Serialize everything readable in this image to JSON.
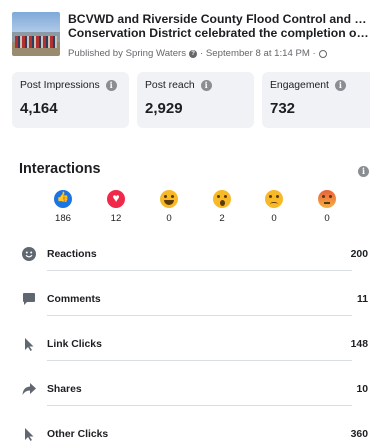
{
  "post": {
    "title_line1": "BCVWD and Riverside County Flood Control and Water",
    "title_line2": "Conservation District celebrated the completion of our...",
    "published_by": "Published by Spring Waters",
    "date": "· September 8 at 1:14 PM ·"
  },
  "metrics": [
    {
      "label": "Post Impressions",
      "value": "4,164"
    },
    {
      "label": "Post reach",
      "value": "2,929"
    },
    {
      "label": "Engagement",
      "value": "732"
    }
  ],
  "interactions": {
    "title": "Interactions",
    "reactions": [
      {
        "icon": "like-icon",
        "count": "186"
      },
      {
        "icon": "love-icon",
        "count": "12"
      },
      {
        "icon": "haha-icon",
        "count": "0"
      },
      {
        "icon": "wow-icon",
        "count": "2"
      },
      {
        "icon": "sad-icon",
        "count": "0"
      },
      {
        "icon": "angry-icon",
        "count": "0"
      }
    ],
    "rows": [
      {
        "icon": "smiley-icon",
        "label": "Reactions",
        "value": "200"
      },
      {
        "icon": "comment-icon",
        "label": "Comments",
        "value": "11"
      },
      {
        "icon": "cursor-icon",
        "label": "Link Clicks",
        "value": "148"
      },
      {
        "icon": "share-icon",
        "label": "Shares",
        "value": "10"
      },
      {
        "icon": "cursor-icon",
        "label": "Other Clicks",
        "value": "360"
      }
    ]
  },
  "colors": {
    "like": "#1b74e4",
    "love": "#f02849",
    "card_bg": "#f0f2f5",
    "text": "#1c1e21"
  }
}
